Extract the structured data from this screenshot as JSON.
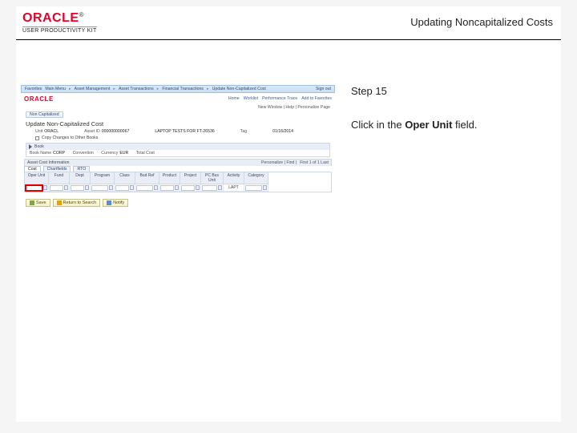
{
  "header": {
    "brand": "ORACLE",
    "brand_sub": "USER PRODUCTIVITY KIT",
    "doc_title": "Updating Noncapitalized Costs"
  },
  "right": {
    "step": "Step 15",
    "instr_pre": "Click in the ",
    "instr_bold": "Oper Unit",
    "instr_post": " field."
  },
  "shot": {
    "crumbs": [
      "Favorites",
      "Main Menu",
      "Asset Management",
      "Asset Transactions",
      "Financial Transactions",
      "Update Non-Capitalized Cost"
    ],
    "signout": "Sign out",
    "toolbar": [
      "Home",
      "Worklist",
      "Performance Trace",
      "Add to Favorites"
    ],
    "newwindow": "New Window | Help | Personalize Page",
    "tab": "Non Capitalized",
    "page_title": "Update Non-Capitalized Cost",
    "meta": {
      "unit_lbl": "Unit",
      "unit_val": "ORACL",
      "asset_lbl": "Asset ID",
      "asset_val": "000000000067",
      "desc": "LAPTOP TESTS FOR FT-26536",
      "tag_lbl": "Tag",
      "tag_val": "",
      "date_val": "01/16/2014"
    },
    "copy_label": "Copy Changes to Other Books",
    "panel1_title": "Book",
    "panel1": {
      "book_lbl": "Book Name",
      "book_val": "CORP",
      "convention_lbl": "Convention",
      "convention_val": "",
      "currency_lbl": "Currency",
      "currency_val": "EUR",
      "cost_lbl": "Total Cost",
      "cost_val": ""
    },
    "section_title": "Asset Cost Information",
    "grid_tabs": [
      "Cost",
      "Chartfields",
      "RTO"
    ],
    "grid_controls": {
      "personalize": "Personalize | Find |",
      "count": "First 1 of 1 Last"
    },
    "grid_cols": [
      "Oper Unit",
      "Fund",
      "Dept",
      "Program",
      "Class",
      "Bud Ref",
      "Product",
      "Project",
      "PC Bus Unit",
      "Activity",
      "Category"
    ],
    "grid_row": [
      "",
      "",
      "",
      "",
      "",
      "",
      "",
      "",
      "",
      "LAPT",
      ""
    ],
    "footer_buttons": [
      "Save",
      "Return to Search",
      "Notify"
    ]
  }
}
